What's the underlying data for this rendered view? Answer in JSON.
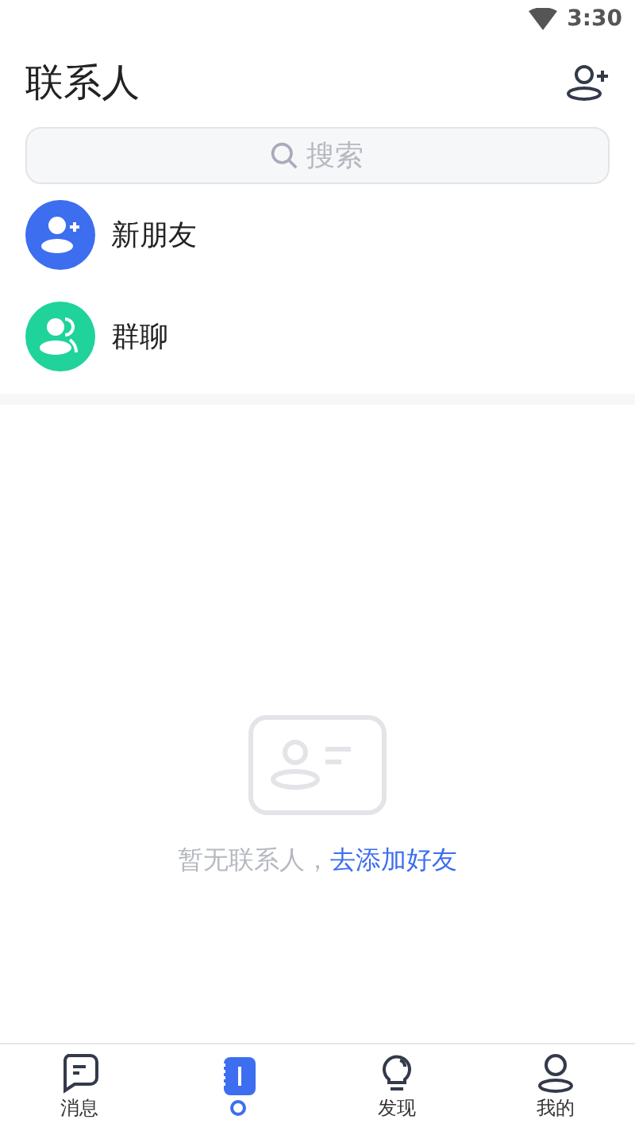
{
  "status_bar": {
    "time": "3:30"
  },
  "header": {
    "title": "联系人"
  },
  "search": {
    "placeholder": "搜索"
  },
  "entries": [
    {
      "kind": "new-friend",
      "label": "新朋友",
      "color": "#3d6ef0"
    },
    {
      "kind": "group",
      "label": "群聊",
      "color": "#1fd39a"
    }
  ],
  "empty_state": {
    "message": "暂无联系人，",
    "link": "去添加好友"
  },
  "tabs": [
    {
      "kind": "messages",
      "label": "消息",
      "selected": false
    },
    {
      "kind": "contacts",
      "selected": true
    },
    {
      "kind": "discover",
      "label": "发现",
      "selected": false
    },
    {
      "kind": "me",
      "label": "我的",
      "selected": false
    }
  ]
}
